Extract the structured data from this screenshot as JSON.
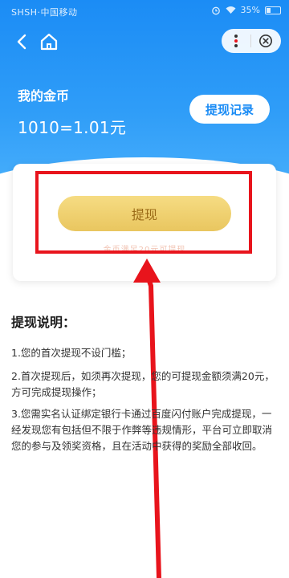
{
  "status_bar": {
    "left_text": "SHSH·中国移动",
    "battery_text": "35%",
    "battery_level": 0.35
  },
  "nav": {
    "back_icon": "back-chevron-icon",
    "home_icon": "home-icon",
    "more_icon": "more-dots-icon",
    "close_icon": "close-circle-icon"
  },
  "coins": {
    "label": "我的金币",
    "value": "1010=1.01元"
  },
  "records_button": {
    "label": "提现记录"
  },
  "withdraw": {
    "button_label": "提现",
    "hint": "金币满足20元可提现"
  },
  "rules": {
    "title": "提现说明：",
    "items": [
      "1.您的首次提现不设门槛；",
      "2.首次提现后，如须再次提现，您的可提现金额须满20元，方可完成提现操作；",
      "3.您需实名认证绑定银行卡通过百度闪付账户完成提现，一经发现您有包括但不限于作弊等违规情形，平台可立即取消您的参与及领奖资格，且在活动中获得的奖励全部收回。"
    ]
  },
  "annotation": {
    "highlight_color": "#e8141c",
    "arrow_color": "#e8141c"
  },
  "colors": {
    "header_blue": "#1b8cf5",
    "button_gold": "#e9c65f"
  }
}
